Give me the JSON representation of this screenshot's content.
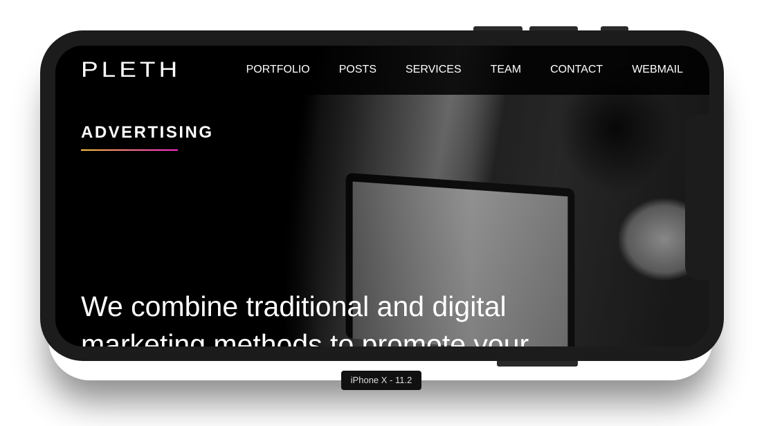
{
  "site": {
    "logo": "PLETH",
    "nav": [
      {
        "label": "PORTFOLIO"
      },
      {
        "label": "POSTS"
      },
      {
        "label": "SERVICES"
      },
      {
        "label": "TEAM"
      },
      {
        "label": "CONTACT"
      },
      {
        "label": "WEBMAIL"
      }
    ]
  },
  "hero": {
    "section_title": "ADVERTISING",
    "headline": "We combine traditional and digital marketing methods to promote your",
    "accent_gradient": [
      "#ffc53b",
      "#ff2dd3"
    ]
  },
  "device": {
    "label": "iPhone X - 11.2"
  }
}
